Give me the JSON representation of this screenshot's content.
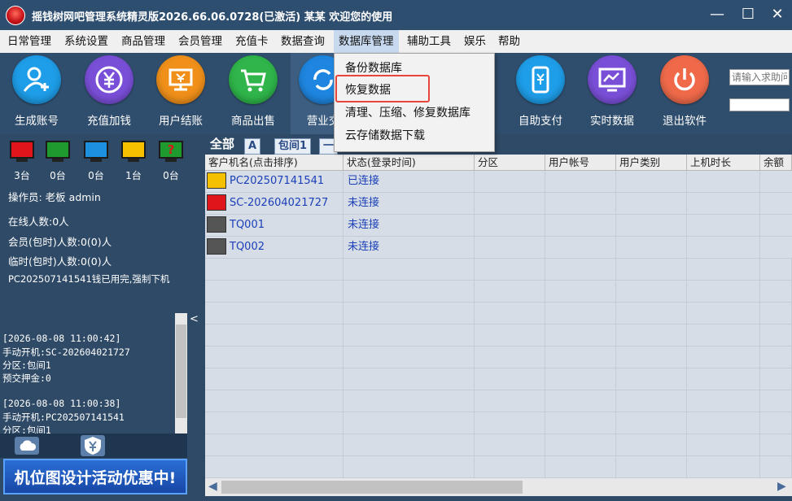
{
  "window": {
    "title": "摇钱树网吧管理系统精灵版2026.66.06.0728(已激活)  某某 欢迎您的使用",
    "minimize": "—",
    "maximize": "☐",
    "close": "✕"
  },
  "menu": [
    "日常管理",
    "系统设置",
    "商品管理",
    "会员管理",
    "充值卡",
    "数据查询",
    "数据库管理",
    "辅助工具",
    "娱乐",
    "帮助"
  ],
  "dropdown": [
    "备份数据库",
    "恢复数据",
    "清理、压缩、修复数据库",
    "云存储数据下载"
  ],
  "toolbar": [
    {
      "label": "生成账号",
      "icon": "add-user-icon",
      "color": "#1e9de8"
    },
    {
      "label": "充值加钱",
      "icon": "yuan-icon",
      "color": "#7a4fd8"
    },
    {
      "label": "用户结账",
      "icon": "cashier-icon",
      "color": "#f0901a"
    },
    {
      "label": "商品出售",
      "icon": "cart-icon",
      "color": "#2fb54a"
    },
    {
      "label": "营业交",
      "icon": "refresh-icon",
      "color": "#1e86e0"
    },
    {
      "label": "自助支付",
      "icon": "phone-pay-icon",
      "color": "#1e9de8"
    },
    {
      "label": "实时数据",
      "icon": "monitor-chart-icon",
      "color": "#7a4fd8"
    },
    {
      "label": "退出软件",
      "icon": "power-icon",
      "color": "#f06a4a"
    }
  ],
  "search": {
    "placeholder": "请输入求助问"
  },
  "status_monitors": [
    {
      "color": "#e0141b",
      "count": "3台"
    },
    {
      "color": "#1f9a2e",
      "count": "0台"
    },
    {
      "color": "#1e90e0",
      "count": "0台"
    },
    {
      "color": "#f5c000",
      "count": "1台"
    },
    {
      "color": "#1f9a2e",
      "count": "0台",
      "mark": "?"
    }
  ],
  "left_info": {
    "operator": "操作员:   老板 admin",
    "online": "在线人数:0人",
    "member": "会员(包时)人数:0(0)人",
    "temp": "临时(包时)人数:0(0)人",
    "notice": "PC202507141541钱已用完,强制下机"
  },
  "log": [
    "[2026-08-08 11:00:42]",
    " 手动开机:SC-202604021727",
    "     分区:包间1",
    " 预交押金:0",
    "",
    "[2026-08-08 11:00:38]",
    " 手动开机:PC202507141541",
    "     分区:包间1"
  ],
  "banner": "机位图设计活动优惠中!",
  "tabs": [
    "全部",
    "A",
    "包间1",
    "一"
  ],
  "columns": [
    "客户机名(点击排序)",
    "状态(登录时间)",
    "分区",
    "用户帐号",
    "用户类别",
    "上机时长",
    "余额"
  ],
  "rows": [
    {
      "name": "PC202507141541",
      "status": "已连接",
      "monitor": "#f5c000"
    },
    {
      "name": "SC-202604021727",
      "status": "未连接",
      "monitor": "#e0141b"
    },
    {
      "name": "TQ001",
      "status": "未连接",
      "monitor": "#555555"
    },
    {
      "name": "TQ002",
      "status": "未连接",
      "monitor": "#555555"
    }
  ],
  "splitter_arrow": "<"
}
